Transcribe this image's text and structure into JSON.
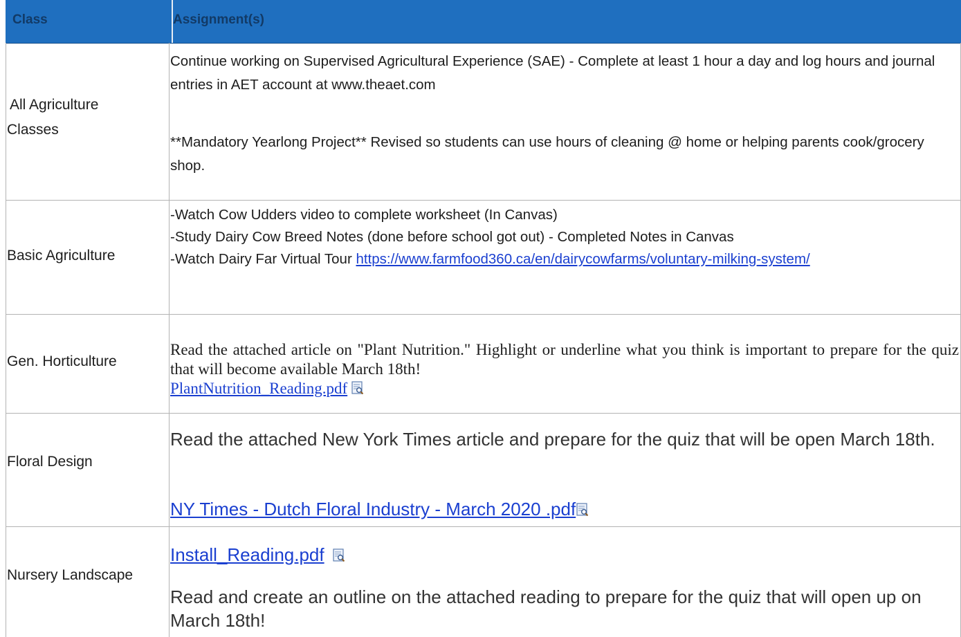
{
  "table": {
    "headers": {
      "class": "Class",
      "assignments": "Assignment(s)"
    },
    "rows": [
      {
        "class_lines": [
          "All Agriculture",
          "Classes"
        ],
        "text1": "Continue working on Supervised Agricultural Experience (SAE) - Complete at least 1 hour a day and log hours and journal entries in AET account at www.theaet.com",
        "text2": "**Mandatory Yearlong Project** Revised so students can use hours of cleaning @ home or helping parents cook/grocery shop."
      },
      {
        "class": "Basic Agriculture",
        "line1": "-Watch Cow Udders video to complete worksheet (In Canvas)",
        "line2": "-Study Dairy Cow Breed Notes (done before school got out) - Completed Notes in Canvas",
        "line3_prefix": "-Watch Dairy Far Virtual Tour ",
        "link": "https://www.farmfood360.ca/en/dairycowfarms/voluntary-milking-system/"
      },
      {
        "class": "Gen. Horticulture",
        "text": "Read the attached article on \"Plant Nutrition.\" Highlight or underline what you think is important to prepare for the quiz that will become available March 18th!",
        "link": "PlantNutrition_Reading.pdf"
      },
      {
        "class": "Floral Design",
        "text": "Read the attached New York Times article and prepare for the quiz that will be open March 18th.",
        "link": "NY Times - Dutch Floral Industry  - March 2020 .pdf"
      },
      {
        "class": "Nursery Landscape",
        "link": "Install_Reading.pdf",
        "text": "Read and create an outline on the attached reading to prepare for the quiz that will open up on March 18th!"
      }
    ]
  },
  "icons": {
    "pdf": "pdf-preview-icon"
  },
  "colors": {
    "header_bg": "#1f6fbf",
    "header_text": "#123a66",
    "link": "#1a3fd0"
  }
}
